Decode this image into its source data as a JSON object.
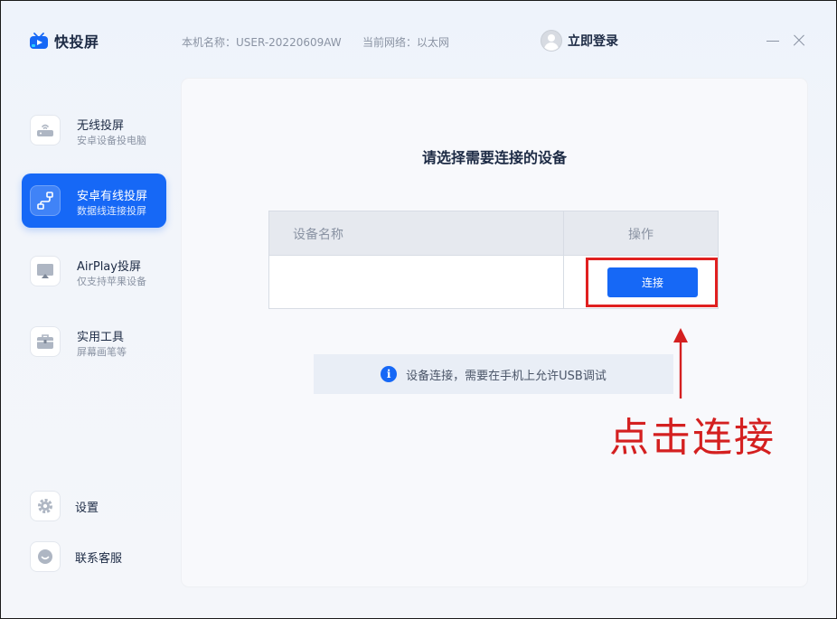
{
  "app": {
    "name": "快投屏",
    "machine_label": "本机名称：USER-20220609AW",
    "network_label": "当前网络：以太网",
    "login_label": "立即登录"
  },
  "sidebar": {
    "items": [
      {
        "title": "无线投屏",
        "subtitle": "安卓设备投电脑",
        "icon": "router-icon",
        "active": false
      },
      {
        "title": "安卓有线投屏",
        "subtitle": "数据线连接投屏",
        "icon": "usb-cable-icon",
        "active": true
      },
      {
        "title": "AirPlay投屏",
        "subtitle": "仅支持苹果设备",
        "icon": "airplay-icon",
        "active": false
      },
      {
        "title": "实用工具",
        "subtitle": "屏幕画笔等",
        "icon": "toolbox-icon",
        "active": false
      }
    ],
    "bottom": [
      {
        "label": "设置",
        "icon": "gear-icon"
      },
      {
        "label": "联系客服",
        "icon": "chat-bubble-icon"
      }
    ]
  },
  "main": {
    "heading": "请选择需要连接的设备",
    "table": {
      "columns": [
        "设备名称",
        "操作"
      ],
      "rows": [
        {
          "device_name": "",
          "action_label": "连接"
        }
      ]
    },
    "notice": "设备连接，需要在手机上允许USB调试"
  },
  "annotation": {
    "text": "点击连接",
    "color": "#d42020"
  },
  "colors": {
    "accent": "#1668f6",
    "highlight": "#e02020"
  }
}
